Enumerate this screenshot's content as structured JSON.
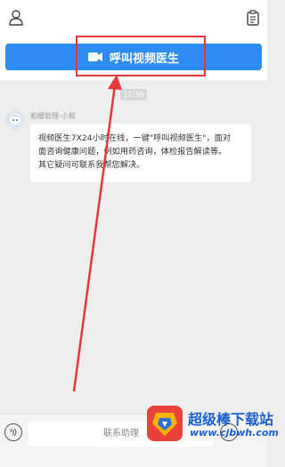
{
  "call_button": {
    "label": "呼叫视频医生"
  },
  "chat": {
    "timestamp": "11:36",
    "sender_name": "和缓助理-小和",
    "message_lines": [
      "视频医生7X24小时在线，一键\"呼叫视频医生\"，面对",
      "面咨询健康问题，例如用药咨询，体检报告解读等。",
      "其它疑问可联系我帮您解决。"
    ]
  },
  "input": {
    "placeholder": "联系助理"
  },
  "watermark": {
    "title": "超级棒下载站",
    "url": "www.cjbwh.com"
  },
  "colors": {
    "call_button": "#2e8cf0",
    "highlight": "#e4393c",
    "watermark": "#1a5fd0"
  }
}
